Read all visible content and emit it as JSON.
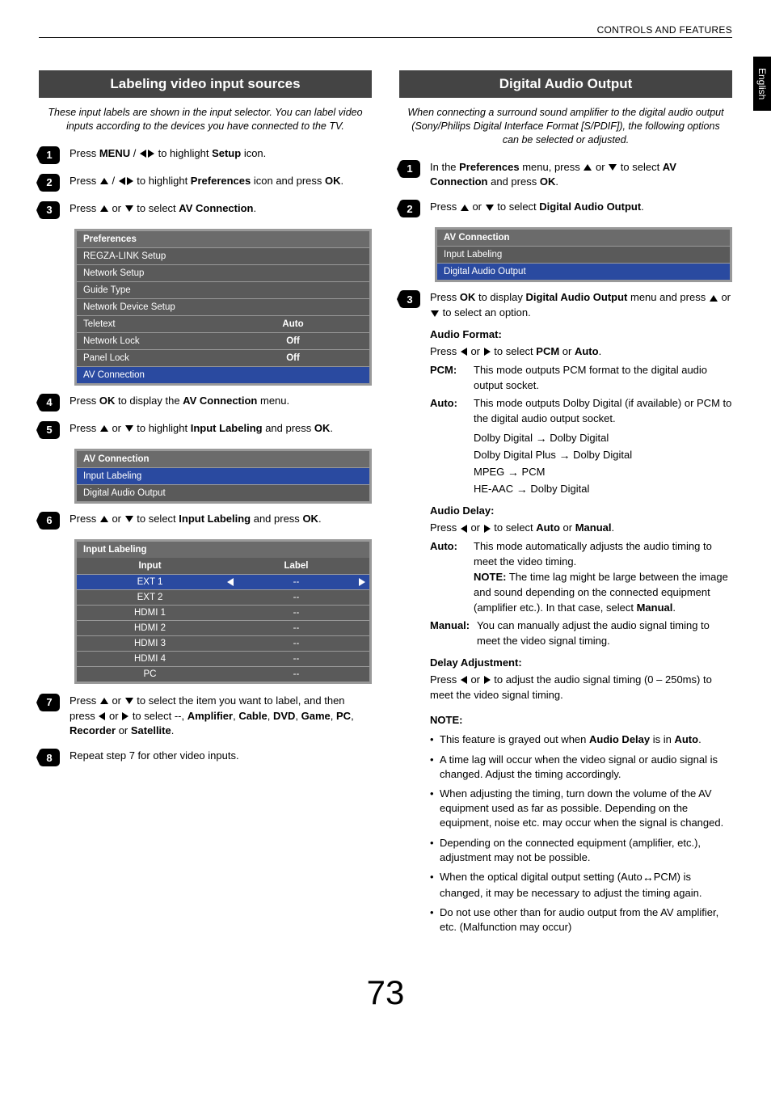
{
  "header": {
    "title": "CONTROLS AND FEATURES",
    "lang_tab": "English"
  },
  "page_number": "73",
  "left": {
    "section_title": "Labeling video input sources",
    "intro": "These input labels are shown in the input selector. You can label video inputs according to the devices you have connected to the TV.",
    "step1": {
      "pre": "Press ",
      "menu": "MENU",
      "mid": " / ",
      "post": " to highlight ",
      "setup": "Setup",
      "end": " icon."
    },
    "step2": {
      "pre": "Press ",
      "mid": " / ",
      "post": " to highlight ",
      "pref": "Preferences",
      "end": " icon and press ",
      "ok": "OK",
      "dot": "."
    },
    "step3": {
      "pre": "Press ",
      "mid": " or ",
      "post": " to select ",
      "av": "AV Connection",
      "dot": "."
    },
    "pref_menu": {
      "title": "Preferences",
      "rows": [
        {
          "label": "REGZA-LINK Setup",
          "value": ""
        },
        {
          "label": "Network Setup",
          "value": ""
        },
        {
          "label": "Guide Type",
          "value": ""
        },
        {
          "label": "Network Device Setup",
          "value": ""
        },
        {
          "label": "Teletext",
          "value": "Auto"
        },
        {
          "label": "Network Lock",
          "value": "Off"
        },
        {
          "label": "Panel Lock",
          "value": "Off"
        },
        {
          "label": "AV Connection",
          "value": "",
          "selected": true
        }
      ]
    },
    "step4": {
      "pre": "Press ",
      "ok": "OK",
      "mid": " to display the ",
      "av": "AV Connection",
      "end": " menu."
    },
    "step5": {
      "pre": "Press ",
      "mid": " or ",
      "post": " to highlight ",
      "il": "Input Labeling",
      "end": " and press ",
      "ok": "OK",
      "dot": "."
    },
    "av_menu": {
      "title": "AV Connection",
      "rows": [
        {
          "label": "Input Labeling",
          "selected": true
        },
        {
          "label": "Digital Audio Output"
        }
      ]
    },
    "step6": {
      "pre": "Press ",
      "mid": " or ",
      "post": " to select ",
      "il": "Input Labeling",
      "end": " and press ",
      "ok": "OK",
      "dot": "."
    },
    "label_table": {
      "title": "Input Labeling",
      "head_input": "Input",
      "head_label": "Label",
      "rows": [
        {
          "input": "EXT 1",
          "label": "--",
          "selected": true
        },
        {
          "input": "EXT 2",
          "label": "--"
        },
        {
          "input": "HDMI 1",
          "label": "--"
        },
        {
          "input": "HDMI 2",
          "label": "--"
        },
        {
          "input": "HDMI 3",
          "label": "--"
        },
        {
          "input": "HDMI 4",
          "label": "--"
        },
        {
          "input": "PC",
          "label": "--"
        }
      ]
    },
    "step7": {
      "pre": "Press ",
      "mid": " or ",
      "post": " to select the item you want to label, and then press ",
      "mid2": " or ",
      "post2": " to select --, ",
      "o1": "Amplifier",
      "c": ", ",
      "o2": "Cable",
      "o3": "DVD",
      "o4": "Game",
      "o5": "PC",
      "o6": "Recorder",
      "or": " or ",
      "o7": "Satellite",
      "dot": "."
    },
    "step8": {
      "text": "Repeat step 7 for other video inputs."
    }
  },
  "right": {
    "section_title": "Digital Audio Output",
    "intro": "When connecting a surround sound amplifier to the digital audio output (Sony/Philips Digital Interface Format [S/PDIF]), the following options can be selected or adjusted.",
    "step1": {
      "pre": "In the ",
      "pref": "Preferences",
      "mid": " menu, press ",
      "or": " or ",
      "post": " to select ",
      "av": "AV Connection",
      "end": " and press ",
      "ok": "OK",
      "dot": "."
    },
    "step2": {
      "pre": "Press ",
      "or": " or ",
      "post": " to select ",
      "dao": "Digital Audio Output",
      "dot": "."
    },
    "av_menu": {
      "title": "AV Connection",
      "rows": [
        {
          "label": "Input Labeling"
        },
        {
          "label": "Digital Audio Output",
          "selected": true
        }
      ]
    },
    "step3": {
      "pre": "Press ",
      "ok": "OK",
      "mid": " to display ",
      "dao": "Digital Audio Output",
      "post": " menu and press ",
      "or": " or ",
      "end": " to select an option."
    },
    "af_head": "Audio Format:",
    "af_line": {
      "pre": "Press ",
      "or": " or ",
      "post": " to select ",
      "a": "PCM",
      "or2": " or ",
      "b": "Auto",
      "dot": "."
    },
    "pcm_k": "PCM:",
    "pcm_v": "This mode outputs PCM format to the digital audio output socket.",
    "auto_k": "Auto:",
    "auto_v": "This mode outputs Dolby Digital (if available) or PCM to the digital audio output socket.",
    "map1a": "Dolby Digital",
    "map1b": "Dolby Digital",
    "map2a": "Dolby Digital Plus",
    "map2b": "Dolby Digital",
    "map3a": "MPEG",
    "map3b": "PCM",
    "map4a": "HE-AAC",
    "map4b": "Dolby Digital",
    "ad_head": "Audio Delay:",
    "ad_line": {
      "pre": "Press ",
      "or": " or ",
      "post": " to select ",
      "a": "Auto",
      "or2": " or ",
      "b": "Manual",
      "dot": "."
    },
    "ad_auto_k": "Auto:",
    "ad_auto_v1": "This mode automatically adjusts the audio timing to meet the video timing.",
    "ad_auto_note_k": "NOTE:",
    "ad_auto_note_v": " The time lag might be large between the image and sound depending on the connected equipment (amplifier etc.). In that case, select ",
    "ad_auto_note_m": "Manual",
    "ad_auto_note_dot": ".",
    "ad_man_k": "Manual:",
    "ad_man_v": "You can manually adjust the audio signal timing to meet the video signal timing.",
    "da_head": "Delay Adjustment:",
    "da_line": {
      "pre": "Press ",
      "or": " or ",
      "post": " to adjust the audio signal timing (0 – 250ms) to meet the video signal timing."
    },
    "note_head": "NOTE:",
    "notes": [
      {
        "pre": "This feature is grayed out when ",
        "b": "Audio Delay",
        "post": " is in ",
        "b2": "Auto",
        "dot": "."
      },
      {
        "text": "A time lag will occur when the video signal or audio signal is changed. Adjust the timing accordingly."
      },
      {
        "text": "When adjusting the timing, turn down the volume of the AV equipment used as far as possible. Depending on the equipment, noise etc. may occur when the signal is changed."
      },
      {
        "text": "Depending on the connected equipment (amplifier, etc.), adjustment may not be possible."
      },
      {
        "pre": "When the optical digital output setting (Auto",
        "post": "PCM) is changed, it may be necessary to adjust the timing again."
      },
      {
        "text": "Do not use other than for audio output from the AV amplifier, etc. (Malfunction may occur)"
      }
    ]
  }
}
